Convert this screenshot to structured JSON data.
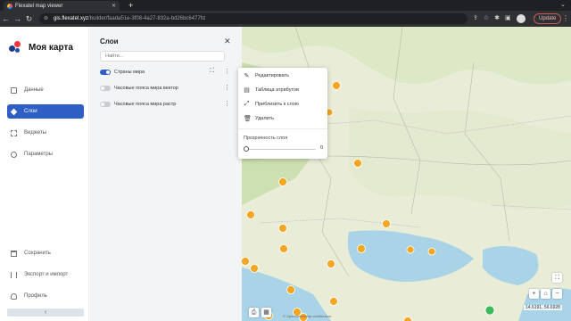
{
  "browser": {
    "tab_title": "Flexatel map viewer",
    "tab_close": "✕",
    "new_tab": "+",
    "url_domain": "gis.flexatel.xyz",
    "url_path": "/builder/faada51e-3f08-4a27-832a-bd26bc6477fd",
    "update_label": "Update"
  },
  "brand": {
    "title": "Моя карта"
  },
  "nav": {
    "data": "Данные",
    "layers": "Слои",
    "widgets": "Виджеты",
    "settings": "Параметры",
    "save": "Сохранить",
    "export": "Экспорт и импорт",
    "profile": "Профиль",
    "collapse": "‹"
  },
  "layers_panel": {
    "title": "Слои",
    "close": "✕",
    "search_placeholder": "Найти...",
    "items": [
      {
        "label": "Страны мира",
        "enabled": true
      },
      {
        "label": "Часовые пояса мира вектор",
        "enabled": false
      },
      {
        "label": "Часовые пояса мира растр",
        "enabled": false
      }
    ]
  },
  "context_menu": {
    "edit": "Редактировать",
    "attributes": "Таблица атрибутов",
    "zoom": "Приблизить к слою",
    "delete": "Удалить",
    "opacity_label": "Прозрачность слоя",
    "opacity_value": "0"
  },
  "map": {
    "coords": "14.6191, 56.6928",
    "attribution": "© OpenStreetMap contributors"
  },
  "colors": {
    "accent": "#2d5fc4",
    "marker": "#f5a623",
    "brand_red": "#ef3340"
  }
}
